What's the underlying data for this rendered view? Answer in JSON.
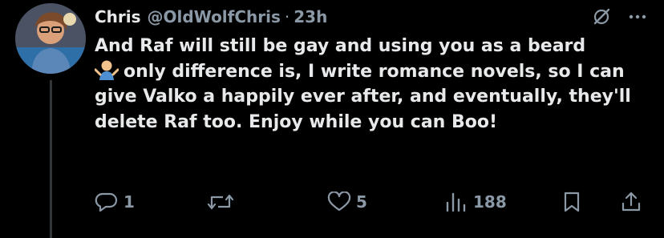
{
  "tweet": {
    "display_name": "Chris",
    "handle": "@OldWolfChris",
    "separator": "·",
    "time": "23h",
    "text_before_emoji": "And Raf will still be gay and using you as a beard",
    "emoji": "person-shrugging",
    "text_after_emoji": "only difference is, I write romance novels, so I can give Valko a happily ever after, and eventually, they'll delete Raf too. Enjoy while you can Boo!"
  },
  "actions": {
    "replies": "1",
    "reposts": "",
    "likes": "5",
    "views": "188"
  },
  "icons": {
    "header": [
      "grok-icon",
      "more-icon"
    ],
    "actions": [
      "reply-icon",
      "repost-icon",
      "like-icon",
      "views-icon",
      "bookmark-icon",
      "share-icon"
    ]
  },
  "colors": {
    "background": "#000000",
    "text": "#e7e9ea",
    "muted": "#8b98a5",
    "thread_line": "#333639"
  }
}
